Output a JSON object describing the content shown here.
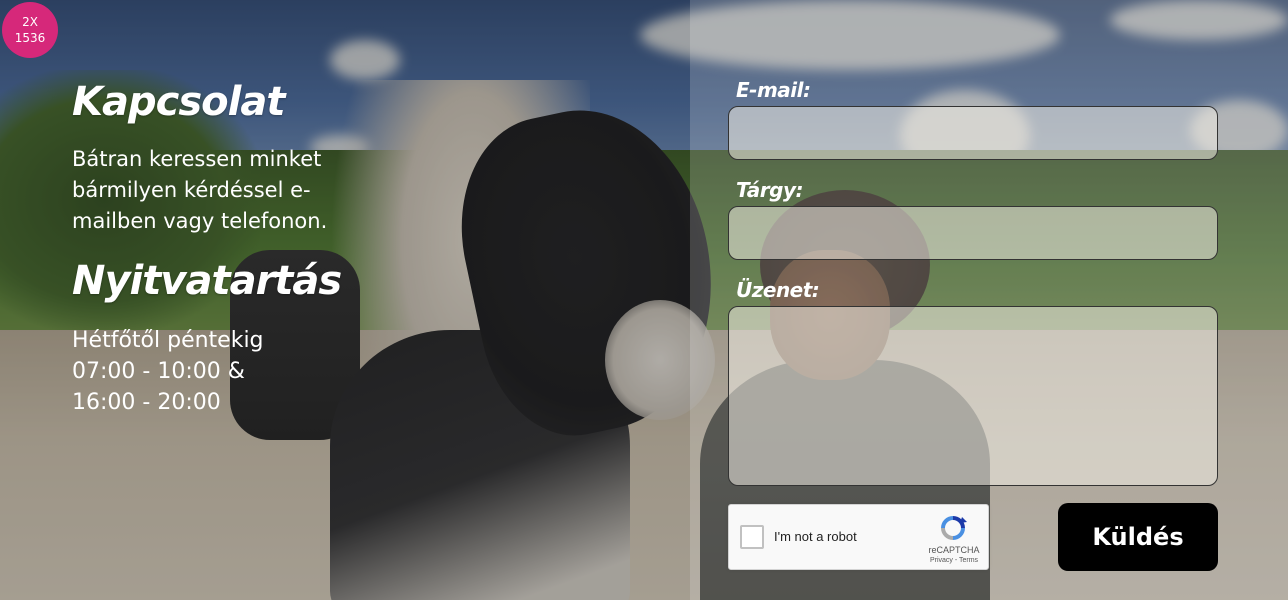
{
  "badge": {
    "line1": "2X",
    "line2": "1536"
  },
  "contact": {
    "title": "Kapcsolat",
    "intro": "Bátran keressen minket bármilyen kérdéssel e-mailben vagy telefonon."
  },
  "hours": {
    "title": "Nyitvatartás",
    "line1": "Hétfőtől péntekig",
    "line2": "07:00 - 10:00 &",
    "line3": "16:00 - 20:00"
  },
  "form": {
    "email_label": "E-mail:",
    "email_value": "",
    "subject_label": "Tárgy:",
    "subject_value": "",
    "message_label": "Üzenet:",
    "message_value": "",
    "submit_label": "Küldés"
  },
  "recaptcha": {
    "label": "I'm not a robot",
    "brand": "reCAPTCHA",
    "terms": "Privacy - Terms",
    "checked": false
  },
  "colors": {
    "badge": "#d6287a",
    "submit_bg": "#000000",
    "text": "#ffffff"
  }
}
